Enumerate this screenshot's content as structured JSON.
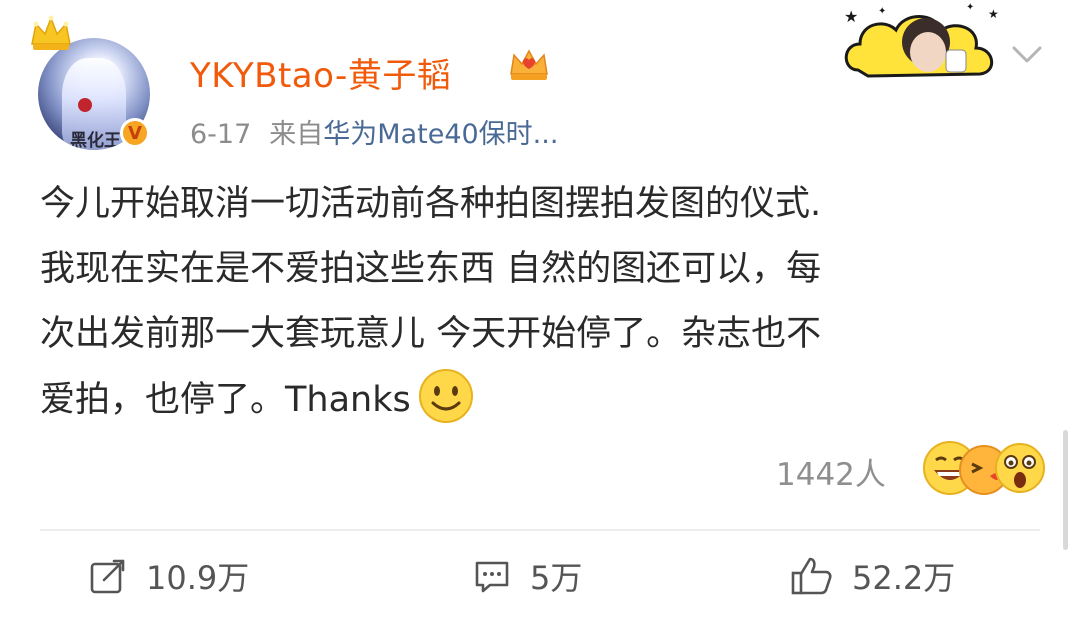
{
  "post": {
    "user": {
      "name": "YKYBtao-黄子韬",
      "verified_badge": "V",
      "avatar_text": "黑化王"
    },
    "date": "6-17",
    "source_prefix": "来自",
    "device": "华为Mate40保时...",
    "text": "今儿开始取消一切活动前各种拍图摆拍发图的仪式.\n我现在实在是不爱拍这些东西 自然的图还可以，每\n次出发前那一大套玩意儿 今天开始停了。杂志也不\n爱拍，也停了。Thanks",
    "reactions": {
      "count_label": "1442人"
    }
  },
  "actions": {
    "repost_count": "10.9万",
    "comment_count": "5万",
    "like_count": "52.2万"
  },
  "colors": {
    "username": "#f05a0a",
    "device_link": "#4a6a96",
    "meta_gray": "#8c8c8c",
    "badge_orange": "#f6a623"
  },
  "icons": [
    "crown-icon",
    "verified-badge-icon",
    "chevron-down-icon",
    "smile-emoji-icon",
    "laugh-emoji-icon",
    "kiss-emoji-icon",
    "surprised-emoji-icon",
    "repost-icon",
    "comment-icon",
    "like-icon"
  ]
}
